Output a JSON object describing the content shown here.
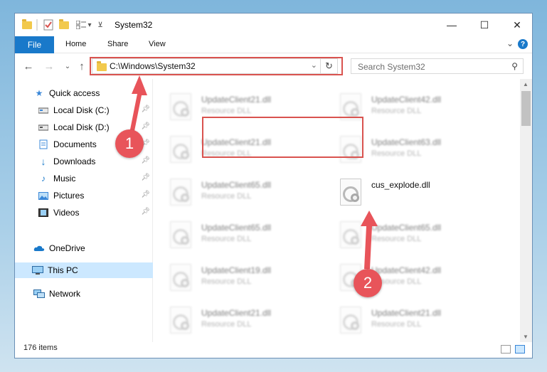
{
  "window": {
    "title": "System32"
  },
  "ribbon": {
    "tabs": [
      {
        "label": "File",
        "active": true
      },
      {
        "label": "Home"
      },
      {
        "label": "Share"
      },
      {
        "label": "View"
      }
    ]
  },
  "navbar": {
    "address": "C:\\Windows\\System32",
    "search_placeholder": "Search System32"
  },
  "sidebar": {
    "items": [
      {
        "label": "Quick access",
        "icon": "star-icon",
        "pinned": false
      },
      {
        "label": "Local Disk (C:)",
        "icon": "drive-icon",
        "pinned": true
      },
      {
        "label": "Local Disk (D:)",
        "icon": "drive-icon",
        "pinned": true
      },
      {
        "label": "Documents",
        "icon": "documents-icon",
        "pinned": true
      },
      {
        "label": "Downloads",
        "icon": "download-icon",
        "pinned": true
      },
      {
        "label": "Music",
        "icon": "music-icon",
        "pinned": true
      },
      {
        "label": "Pictures",
        "icon": "pictures-icon",
        "pinned": true
      },
      {
        "label": "Videos",
        "icon": "videos-icon",
        "pinned": true
      },
      {
        "label": "OneDrive",
        "icon": "cloud-icon",
        "pinned": false
      },
      {
        "label": "This PC",
        "icon": "computer-icon",
        "pinned": false,
        "selected": true
      },
      {
        "label": "Network",
        "icon": "network-icon",
        "pinned": false
      }
    ]
  },
  "files": [
    {
      "name": "UpdateClient21.dll",
      "type": "Resource DLL",
      "blurred": true
    },
    {
      "name": "UpdateClient42.dll",
      "type": "Resource DLL",
      "blurred": true
    },
    {
      "name": "UpdateClient21.dll",
      "type": "Resource DLL",
      "blurred": true
    },
    {
      "name": "UpdateClient63.dll",
      "type": "Resource DLL",
      "blurred": true
    },
    {
      "name": "UpdateClient65.dll",
      "type": "Resource DLL",
      "blurred": true
    },
    {
      "name": "cus_explode.dll",
      "type": "",
      "blurred": false
    },
    {
      "name": "UpdateClient65.dll",
      "type": "Resource DLL",
      "blurred": true
    },
    {
      "name": "UpdateClient65.dll",
      "type": "Resource DLL",
      "blurred": true
    },
    {
      "name": "UpdateClient19.dll",
      "type": "Resource DLL",
      "blurred": true
    },
    {
      "name": "UpdateClient42.dll",
      "type": "Resource DLL",
      "blurred": true
    },
    {
      "name": "UpdateClient21.dll",
      "type": "Resource DLL",
      "blurred": true
    },
    {
      "name": "UpdateClient21.dll",
      "type": "Resource DLL",
      "blurred": true
    }
  ],
  "status": {
    "item_count": "176 items"
  },
  "annotations": {
    "step1": "1",
    "step2": "2",
    "accent_color": "#e8545a"
  }
}
